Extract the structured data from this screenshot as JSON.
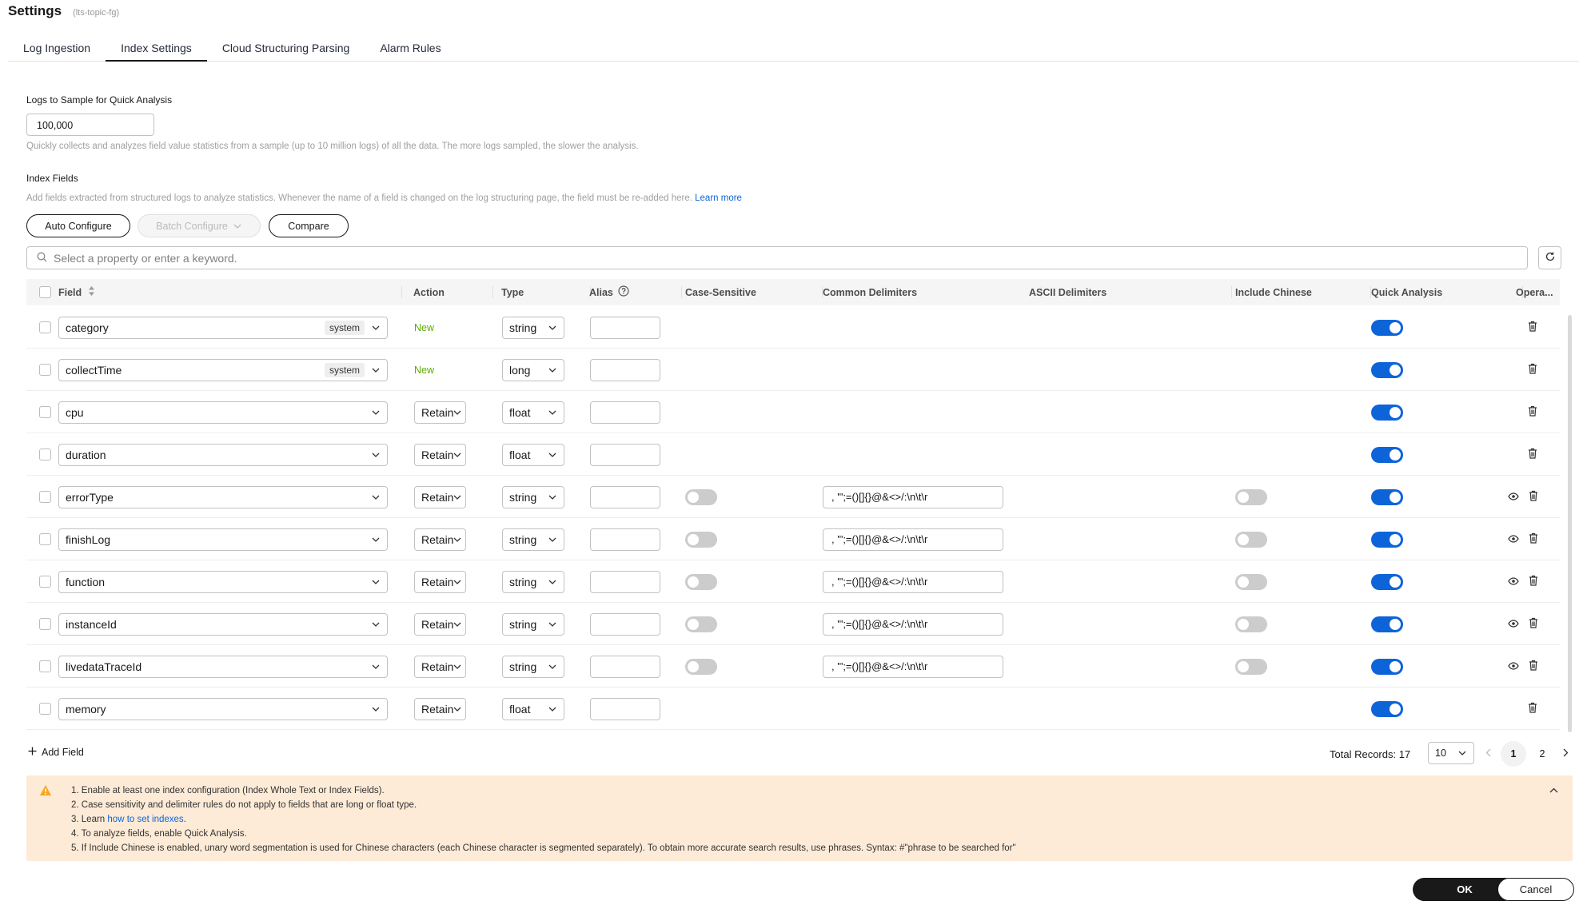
{
  "header": {
    "title": "Settings",
    "subtitle": "(lts-topic-fg)"
  },
  "tabs": [
    {
      "label": "Log Ingestion",
      "active": false
    },
    {
      "label": "Index Settings",
      "active": true
    },
    {
      "label": "Cloud Structuring Parsing",
      "active": false
    },
    {
      "label": "Alarm Rules",
      "active": false
    }
  ],
  "sample": {
    "label": "Logs to Sample for Quick Analysis",
    "value": "100,000",
    "hint": "Quickly collects and analyzes field value statistics from a sample (up to 10 million logs) of all the data. The more logs sampled, the slower the analysis."
  },
  "index_fields": {
    "label": "Index Fields",
    "hint": "Add fields extracted from structured logs to analyze statistics. Whenever the name of a field is changed on the log structuring page, the field must be re-added here.",
    "learn_more": "Learn more",
    "auto_configure": "Auto Configure",
    "batch_configure": "Batch Configure",
    "compare": "Compare",
    "search_placeholder": "Select a property or enter a keyword."
  },
  "columns": {
    "field": "Field",
    "action": "Action",
    "type": "Type",
    "alias": "Alias",
    "case_sensitive": "Case-Sensitive",
    "common_delimiters": "Common Delimiters",
    "ascii_delimiters": "ASCII Delimiters",
    "include_chinese": "Include Chinese",
    "quick_analysis": "Quick Analysis",
    "operation": "Opera..."
  },
  "rows": [
    {
      "field": "category",
      "tag": "system",
      "action": "New",
      "type": "string",
      "quick": true
    },
    {
      "field": "collectTime",
      "tag": "system",
      "action": "New",
      "type": "long",
      "quick": true
    },
    {
      "field": "cpu",
      "tag": "",
      "action": "Retain",
      "type": "float",
      "quick": true
    },
    {
      "field": "duration",
      "tag": "",
      "action": "Retain",
      "type": "float",
      "quick": true
    },
    {
      "field": "errorType",
      "tag": "",
      "action": "Retain",
      "type": "string",
      "case": false,
      "delimiters": ", '\";=()[]{}@&<>/:\\n\\t\\r",
      "chinese": false,
      "quick": true
    },
    {
      "field": "finishLog",
      "tag": "",
      "action": "Retain",
      "type": "string",
      "case": false,
      "delimiters": ", '\";=()[]{}@&<>/:\\n\\t\\r",
      "chinese": false,
      "quick": true
    },
    {
      "field": "function",
      "tag": "",
      "action": "Retain",
      "type": "string",
      "case": false,
      "delimiters": ", '\";=()[]{}@&<>/:\\n\\t\\r",
      "chinese": false,
      "quick": true
    },
    {
      "field": "instanceId",
      "tag": "",
      "action": "Retain",
      "type": "string",
      "case": false,
      "delimiters": ", '\";=()[]{}@&<>/:\\n\\t\\r",
      "chinese": false,
      "quick": true
    },
    {
      "field": "livedataTraceId",
      "tag": "",
      "action": "Retain",
      "type": "string",
      "case": false,
      "delimiters": ", '\";=()[]{}@&<>/:\\n\\t\\r",
      "chinese": false,
      "quick": true
    },
    {
      "field": "memory",
      "tag": "",
      "action": "Retain",
      "type": "float",
      "quick": true
    }
  ],
  "footer": {
    "add_field": "Add Field",
    "total": "Total Records: 17",
    "page_size": "10",
    "pages": [
      "1",
      "2"
    ],
    "current_page": "1"
  },
  "notice": {
    "items": [
      "1. Enable at least one index configuration (Index Whole Text or Index Fields).",
      "2. Case sensitivity and delimiter rules do not apply to fields that are long or float type.",
      "3. Learn ",
      "4. To analyze fields, enable Quick Analysis.",
      "5. If Include Chinese is enabled, unary word segmentation is used for Chinese characters (each Chinese character is segmented separately). To obtain more accurate search results, use phrases. Syntax: #\"phrase to be searched for\""
    ],
    "link": "how to set indexes",
    "link_suffix": "."
  },
  "actions": {
    "ok": "OK",
    "cancel": "Cancel"
  },
  "colors": {
    "accent": "#0d64d9",
    "new_green": "#5dab00",
    "notice_bg": "#fdebd7",
    "warn": "#f5a623"
  }
}
